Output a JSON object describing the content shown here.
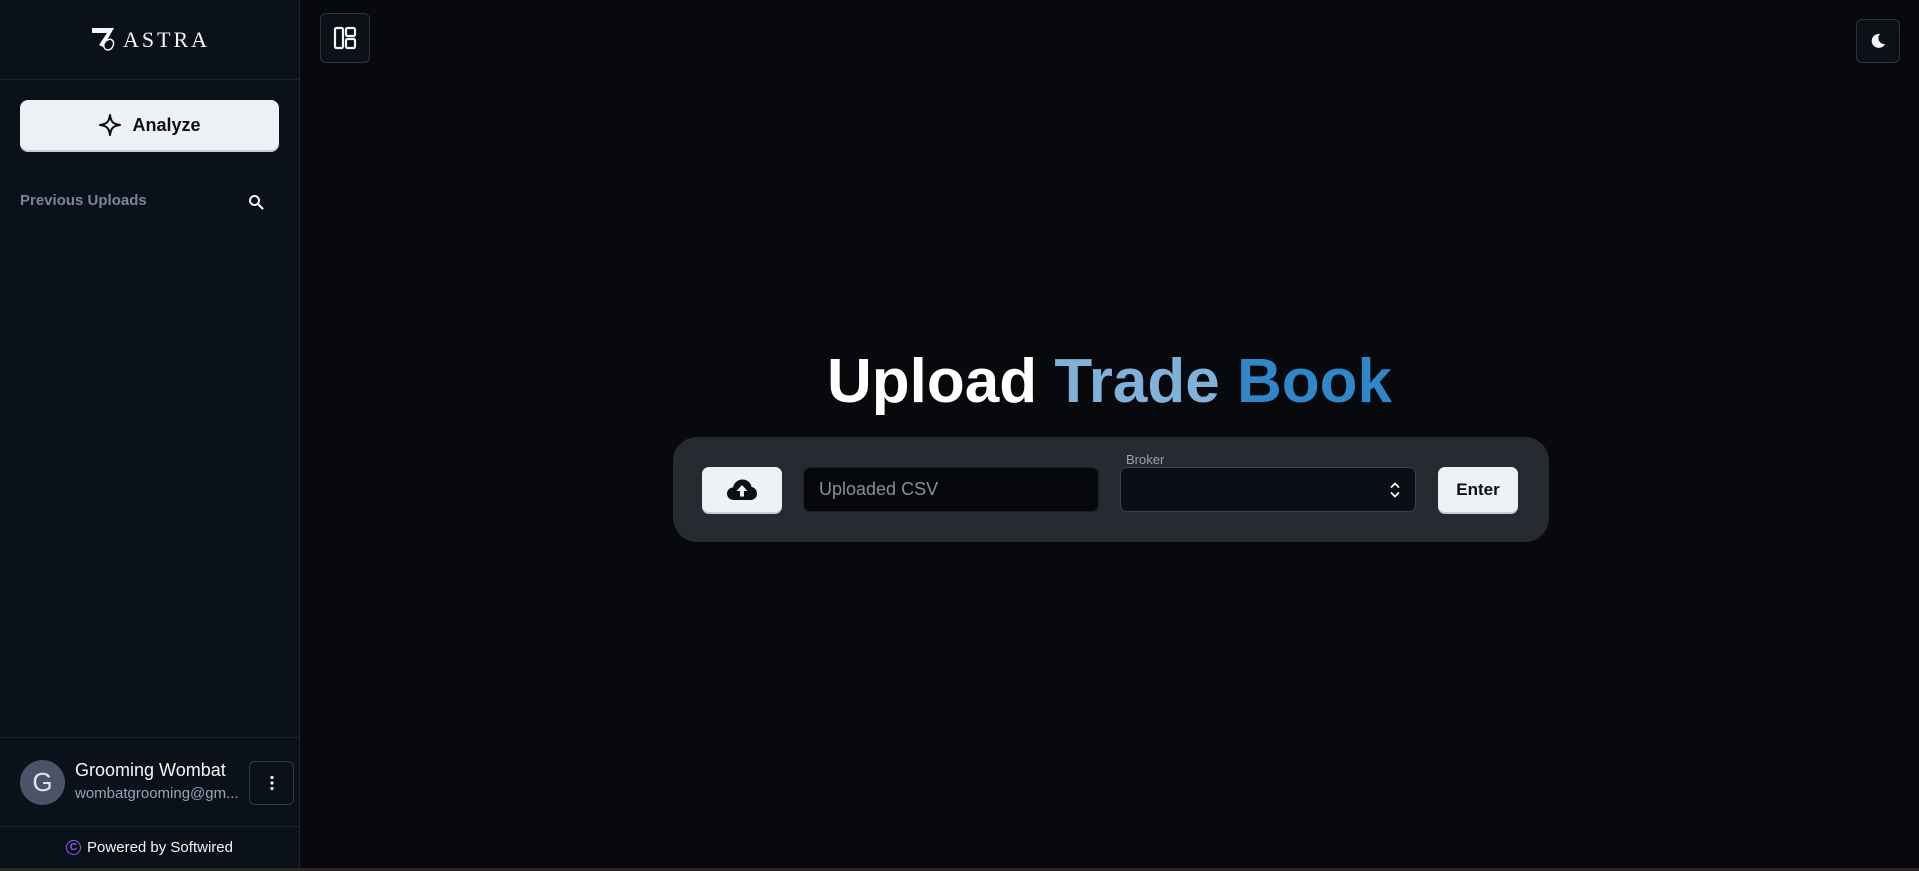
{
  "brand": {
    "name": "ASTRA"
  },
  "sidebar": {
    "analyze_label": "Analyze",
    "previous_uploads_label": "Previous Uploads",
    "user": {
      "initial": "G",
      "name": "Grooming Wombat",
      "email": "wombatgrooming@gm..."
    },
    "footer": {
      "powered_by": "Powered by Softwired",
      "copyright_symbol": "C"
    }
  },
  "main": {
    "title": {
      "word1": "Upload",
      "word2": "Trade",
      "word3": "Book"
    },
    "upload": {
      "csv_placeholder": "Uploaded CSV",
      "broker_label": "Broker",
      "broker_value": "",
      "enter_label": "Enter"
    }
  },
  "icons": {
    "analyze": "sparkle-icon",
    "search": "search-icon",
    "user_menu": "more-vertical-icon",
    "layout": "layout-panel-icon",
    "theme": "moon-icon",
    "upload": "cloud-upload-icon",
    "broker": "chevrons-up-down-icon"
  },
  "colors": {
    "background": "#07090d",
    "sidebar": "#0b111b",
    "panel": "#272a31",
    "title_white": "#ffffff",
    "title_light_blue": "#7fb1d9",
    "title_blue": "#2f86c8",
    "copyright_accent": "#8b5cf6"
  }
}
